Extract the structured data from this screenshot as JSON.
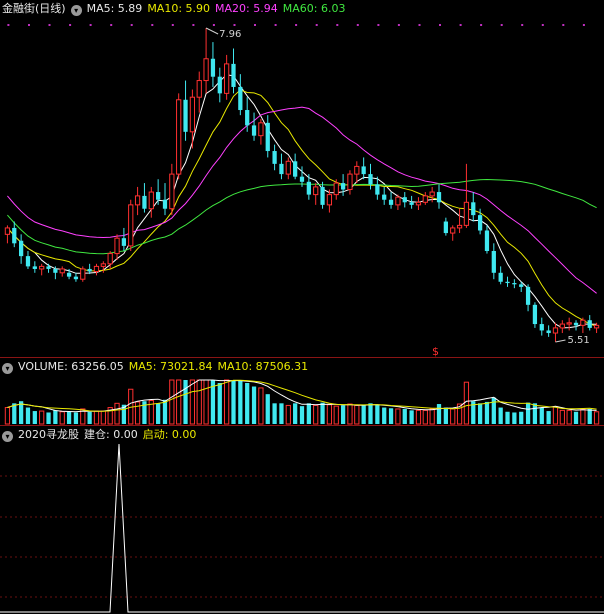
{
  "price_panel": {
    "title": "金融街(日线)",
    "ma5_label": "MA5: 5.89",
    "ma10_label": "MA10: 5.90",
    "ma20_label": "MA20: 5.94",
    "ma60_label": "MA60: 6.03",
    "high_label": "7.96",
    "low_label": "5.51",
    "marker_label": "$",
    "colors": {
      "ma5": "#ffffff",
      "ma10": "#e8e800",
      "ma20": "#ff40ff",
      "ma60": "#40e840",
      "up": "#ff3030",
      "down": "#40e8f0"
    }
  },
  "volume_panel": {
    "volume_label": "VOLUME: 63256.05",
    "ma5_label": "MA5: 73021.84",
    "ma10_label": "MA10: 87506.31"
  },
  "indicator_panel": {
    "title": "2020寻龙股",
    "jiancang_label": "建仓: 0.00",
    "qidong_label": "启动: 0.00"
  },
  "chart_data": {
    "type": "candlestick",
    "high": 7.96,
    "low": 5.51,
    "candles": [
      [
        6.35,
        6.42,
        6.28,
        6.4
      ],
      [
        6.4,
        6.45,
        6.25,
        6.28
      ],
      [
        6.3,
        6.35,
        6.12,
        6.18
      ],
      [
        6.18,
        6.22,
        6.08,
        6.1
      ],
      [
        6.1,
        6.14,
        6.05,
        6.08
      ],
      [
        6.08,
        6.12,
        6.03,
        6.1
      ],
      [
        6.1,
        6.12,
        6.05,
        6.08
      ],
      [
        6.08,
        6.1,
        6.0,
        6.05
      ],
      [
        6.05,
        6.1,
        6.02,
        6.08
      ],
      [
        6.05,
        6.08,
        6.0,
        6.02
      ],
      [
        6.02,
        6.05,
        5.98,
        6.0
      ],
      [
        6.0,
        6.1,
        5.98,
        6.08
      ],
      [
        6.08,
        6.12,
        6.04,
        6.06
      ],
      [
        6.06,
        6.12,
        6.03,
        6.1
      ],
      [
        6.1,
        6.14,
        6.05,
        6.12
      ],
      [
        6.12,
        6.22,
        6.08,
        6.2
      ],
      [
        6.2,
        6.35,
        6.15,
        6.32
      ],
      [
        6.32,
        6.4,
        6.22,
        6.26
      ],
      [
        6.26,
        6.62,
        6.22,
        6.58
      ],
      [
        6.58,
        6.72,
        6.5,
        6.65
      ],
      [
        6.65,
        6.75,
        6.52,
        6.55
      ],
      [
        6.55,
        6.72,
        6.48,
        6.68
      ],
      [
        6.68,
        6.78,
        6.58,
        6.62
      ],
      [
        6.62,
        6.75,
        6.5,
        6.55
      ],
      [
        6.55,
        6.9,
        6.5,
        6.82
      ],
      [
        6.82,
        7.45,
        6.78,
        7.4
      ],
      [
        7.4,
        7.55,
        7.08,
        7.15
      ],
      [
        7.15,
        7.48,
        7.02,
        7.42
      ],
      [
        7.42,
        7.62,
        7.3,
        7.55
      ],
      [
        7.55,
        7.96,
        7.45,
        7.72
      ],
      [
        7.72,
        7.85,
        7.5,
        7.58
      ],
      [
        7.58,
        7.65,
        7.38,
        7.45
      ],
      [
        7.45,
        7.75,
        7.4,
        7.68
      ],
      [
        7.68,
        7.8,
        7.45,
        7.5
      ],
      [
        7.5,
        7.6,
        7.28,
        7.32
      ],
      [
        7.32,
        7.42,
        7.15,
        7.2
      ],
      [
        7.2,
        7.3,
        7.08,
        7.12
      ],
      [
        7.12,
        7.25,
        7.05,
        7.22
      ],
      [
        7.22,
        7.28,
        6.95,
        7.0
      ],
      [
        7.0,
        7.05,
        6.85,
        6.9
      ],
      [
        6.9,
        6.98,
        6.78,
        6.82
      ],
      [
        6.82,
        6.95,
        6.78,
        6.92
      ],
      [
        6.92,
        6.98,
        6.78,
        6.8
      ],
      [
        6.8,
        6.88,
        6.72,
        6.76
      ],
      [
        6.76,
        6.82,
        6.62,
        6.66
      ],
      [
        6.66,
        6.75,
        6.58,
        6.72
      ],
      [
        6.72,
        6.76,
        6.55,
        6.58
      ],
      [
        6.58,
        6.7,
        6.52,
        6.66
      ],
      [
        6.66,
        6.78,
        6.62,
        6.75
      ],
      [
        6.75,
        6.82,
        6.65,
        6.7
      ],
      [
        6.7,
        6.85,
        6.66,
        6.82
      ],
      [
        6.82,
        6.92,
        6.75,
        6.88
      ],
      [
        6.88,
        6.95,
        6.78,
        6.82
      ],
      [
        6.82,
        6.9,
        6.7,
        6.74
      ],
      [
        6.74,
        6.8,
        6.62,
        6.66
      ],
      [
        6.66,
        6.72,
        6.58,
        6.62
      ],
      [
        6.62,
        6.68,
        6.55,
        6.58
      ],
      [
        6.58,
        6.66,
        6.54,
        6.64
      ],
      [
        6.64,
        6.68,
        6.56,
        6.6
      ],
      [
        6.6,
        6.65,
        6.55,
        6.58
      ],
      [
        6.58,
        6.64,
        6.54,
        6.6
      ],
      [
        6.6,
        6.68,
        6.58,
        6.65
      ],
      [
        6.65,
        6.72,
        6.6,
        6.68
      ],
      [
        6.68,
        6.74,
        6.55,
        6.6
      ],
      [
        6.45,
        6.48,
        6.34,
        6.36
      ],
      [
        6.36,
        6.42,
        6.3,
        6.4
      ],
      [
        6.4,
        6.55,
        6.36,
        6.42
      ],
      [
        6.42,
        6.9,
        6.4,
        6.6
      ],
      [
        6.6,
        6.68,
        6.45,
        6.5
      ],
      [
        6.5,
        6.55,
        6.35,
        6.38
      ],
      [
        6.38,
        6.42,
        6.2,
        6.22
      ],
      [
        6.22,
        6.28,
        6.0,
        6.05
      ],
      [
        6.05,
        6.1,
        5.96,
        5.98
      ],
      [
        5.98,
        6.02,
        5.94,
        5.97
      ],
      [
        5.97,
        6.0,
        5.93,
        5.96
      ],
      [
        5.96,
        5.98,
        5.9,
        5.94
      ],
      [
        5.94,
        5.96,
        5.75,
        5.8
      ],
      [
        5.8,
        5.82,
        5.62,
        5.65
      ],
      [
        5.65,
        5.7,
        5.56,
        5.6
      ],
      [
        5.6,
        5.64,
        5.55,
        5.58
      ],
      [
        5.58,
        5.66,
        5.51,
        5.62
      ],
      [
        5.62,
        5.68,
        5.58,
        5.65
      ],
      [
        5.65,
        5.7,
        5.6,
        5.66
      ],
      [
        5.66,
        5.68,
        5.6,
        5.64
      ],
      [
        5.64,
        5.7,
        5.58,
        5.68
      ],
      [
        5.68,
        5.72,
        5.6,
        5.62
      ],
      [
        5.62,
        5.66,
        5.58,
        5.64
      ]
    ]
  }
}
